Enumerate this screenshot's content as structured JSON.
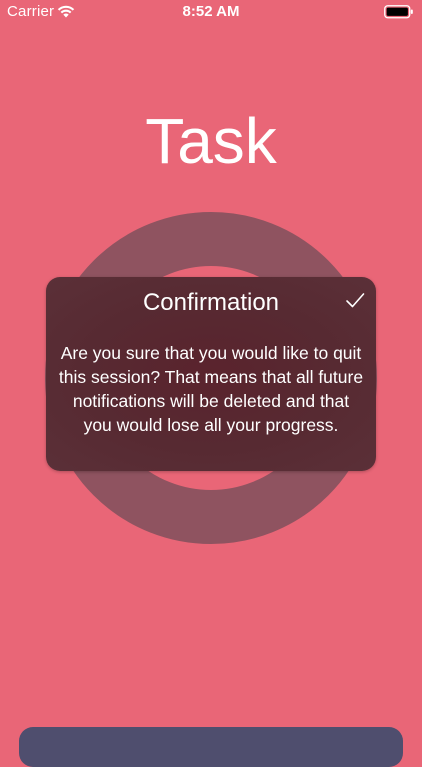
{
  "status_bar": {
    "carrier": "Carrier",
    "time": "8:52 AM",
    "icons": [
      "wifi-icon",
      "battery-icon"
    ]
  },
  "header": {
    "title": "Task"
  },
  "dialog": {
    "title": "Confirmation",
    "message": "Are you sure that you would like to quit this session? That means that all future notifications will be deleted and that you would lose all your progress.",
    "confirm_icon": "checkmark-icon"
  },
  "colors": {
    "background": "#e96677",
    "ring": "#8f5360",
    "dialog": "#572a32",
    "bottom_bar": "#4f4e6e",
    "text": "#ffffff"
  }
}
